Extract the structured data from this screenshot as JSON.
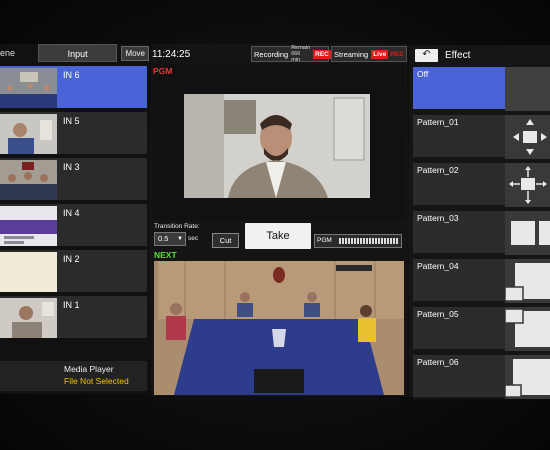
{
  "left_panel": {
    "scene_tab": "ene",
    "input_tab": "Input",
    "move_button": "Move",
    "inputs": [
      {
        "label": "IN 6",
        "active": true
      },
      {
        "label": "IN 5",
        "active": false
      },
      {
        "label": "IN 3",
        "active": false
      },
      {
        "label": "IN 4",
        "active": false
      },
      {
        "label": "IN 2",
        "active": false
      },
      {
        "label": "IN 1",
        "active": false
      }
    ],
    "media_player": {
      "label": "Media Player",
      "status": "File Not Selected"
    }
  },
  "center_panel": {
    "clock": "11:24:25",
    "recording": {
      "label": "Recording",
      "remain_line1": "Remain",
      "remain_line2": "666 min",
      "badge": "REC"
    },
    "streaming": {
      "label": "Streaming",
      "badge_live": "Live",
      "badge_rec": "REC"
    },
    "pgm_label": "PGM",
    "transition_rate_label": "Transition Rate:",
    "transition_rate_value": "0.5",
    "sec_label": "sec",
    "cut_button": "Cut",
    "take_button": "Take",
    "pgm_meter_label": "PGM",
    "next_label": "NEXT"
  },
  "right_panel": {
    "back_icon": "back-arrow-icon",
    "title": "Effect",
    "effects": [
      {
        "label": "Off",
        "active": true,
        "icon": "none"
      },
      {
        "label": "Pattern_01",
        "active": false,
        "icon": "cross-arrows-in"
      },
      {
        "label": "Pattern_02",
        "active": false,
        "icon": "cross-arrows-out"
      },
      {
        "label": "Pattern_03",
        "active": false,
        "icon": "split-horizontal"
      },
      {
        "label": "Pattern_04",
        "active": false,
        "icon": "corner-bottom-left"
      },
      {
        "label": "Pattern_05",
        "active": false,
        "icon": "corner-top-left"
      },
      {
        "label": "Pattern_06",
        "active": false,
        "icon": "corner-bottom-left-small"
      }
    ]
  },
  "colors": {
    "active_blue": "#4a64d8",
    "rec_red": "#e01b1b",
    "pgm_red": "#e23838",
    "next_green": "#56e03a",
    "file_warning_yellow": "#f2c400"
  }
}
